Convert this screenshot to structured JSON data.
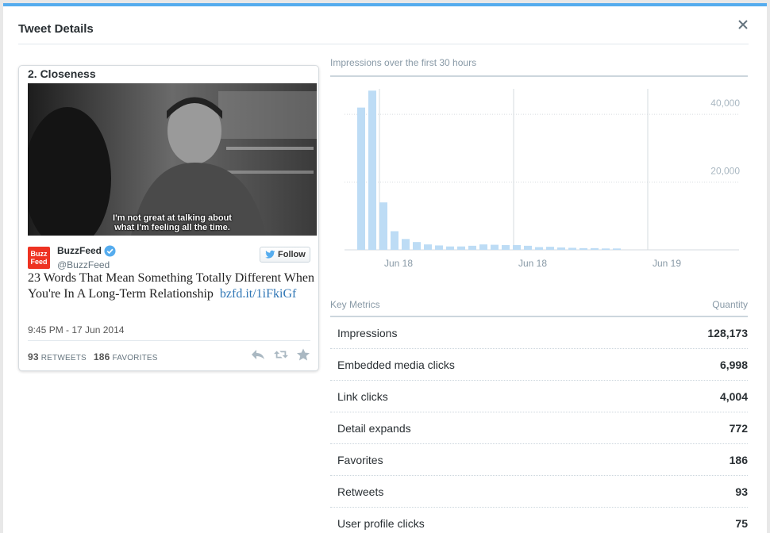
{
  "header": {
    "title": "Tweet Details"
  },
  "tweet": {
    "caption": "2. Closeness",
    "media_subtitle_line1": "I'm not great at talking about",
    "media_subtitle_line2": "what I'm feeling all the time.",
    "avatar_text_line1": "Buzz",
    "avatar_text_line2": "Feed",
    "author_name": "BuzzFeed",
    "author_handle": "@BuzzFeed",
    "follow_label": "Follow",
    "text": "23 Words That Mean Something Totally Different When You're In A Long-Term Relationship",
    "link": "bzfd.it/1iFkiGf",
    "timestamp": "9:45 PM - 17 Jun 2014",
    "retweets_count": "93",
    "retweets_label": "RETWEETS",
    "favorites_count": "186",
    "favorites_label": "FAVORITES"
  },
  "chart_data": {
    "type": "bar",
    "title": "Impressions over the first 30 hours",
    "x_tick_labels": [
      "Jun 18",
      "Jun 18",
      "Jun 19"
    ],
    "y_tick_labels": [
      "40,000",
      "20,000"
    ],
    "y_ticks": [
      40000,
      20000
    ],
    "ylim": [
      0,
      48000
    ],
    "grid": true,
    "values": [
      42000,
      47000,
      14000,
      5500,
      3200,
      2300,
      1600,
      1300,
      1000,
      1000,
      1200,
      1600,
      1500,
      1400,
      1400,
      1200,
      800,
      900,
      700,
      600,
      500,
      500,
      400,
      400
    ],
    "bar_color": "#bddcf5"
  },
  "metrics": {
    "header_left": "Key Metrics",
    "header_right": "Quantity",
    "rows": [
      {
        "label": "Impressions",
        "value": "128,173"
      },
      {
        "label": "Embedded media clicks",
        "value": "6,998"
      },
      {
        "label": "Link clicks",
        "value": "4,004"
      },
      {
        "label": "Detail expands",
        "value": "772"
      },
      {
        "label": "Favorites",
        "value": "186"
      },
      {
        "label": "Retweets",
        "value": "93"
      },
      {
        "label": "User profile clicks",
        "value": "75"
      }
    ]
  },
  "colors": {
    "accent": "#55acee",
    "link": "#2f76b5",
    "verified": "#55acee"
  }
}
